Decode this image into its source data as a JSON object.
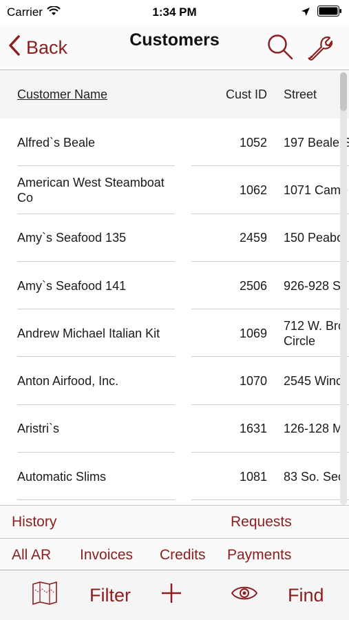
{
  "status": {
    "carrier": "Carrier",
    "time": "1:34 PM"
  },
  "nav": {
    "back_label": "Back",
    "title": "Customers"
  },
  "table": {
    "headers": {
      "name": "Customer Name",
      "id": "Cust ID",
      "street": "Street"
    },
    "rows": [
      {
        "name": "Alfred`s Beale",
        "id": "1052",
        "street": "197 Beale S"
      },
      {
        "name": "American West Steamboat Co",
        "id": "1062",
        "street": "1071 Came"
      },
      {
        "name": "Amy`s Seafood 135",
        "id": "2459",
        "street": "150 Peabo"
      },
      {
        "name": "Amy`s Seafood 141",
        "id": "2506",
        "street": "926-928 S"
      },
      {
        "name": "Andrew Michael Italian Kit",
        "id": "1069",
        "street": "712 W. Bro Circle"
      },
      {
        "name": "Anton Airfood, Inc.",
        "id": "1070",
        "street": "2545 Winc"
      },
      {
        "name": "Aristri`s",
        "id": "1631",
        "street": "126-128 M"
      },
      {
        "name": "Automatic Slims",
        "id": "1081",
        "street": "83 So. Sec"
      }
    ]
  },
  "tabs_row1": {
    "history": "History",
    "requests": "Requests"
  },
  "tabs_row2": {
    "allar": "All AR",
    "invoices": "Invoices",
    "credits": "Credits",
    "payments": "Payments"
  },
  "toolbar": {
    "filter": "Filter",
    "find": "Find"
  },
  "colors": {
    "accent": "#8b1e1e"
  }
}
